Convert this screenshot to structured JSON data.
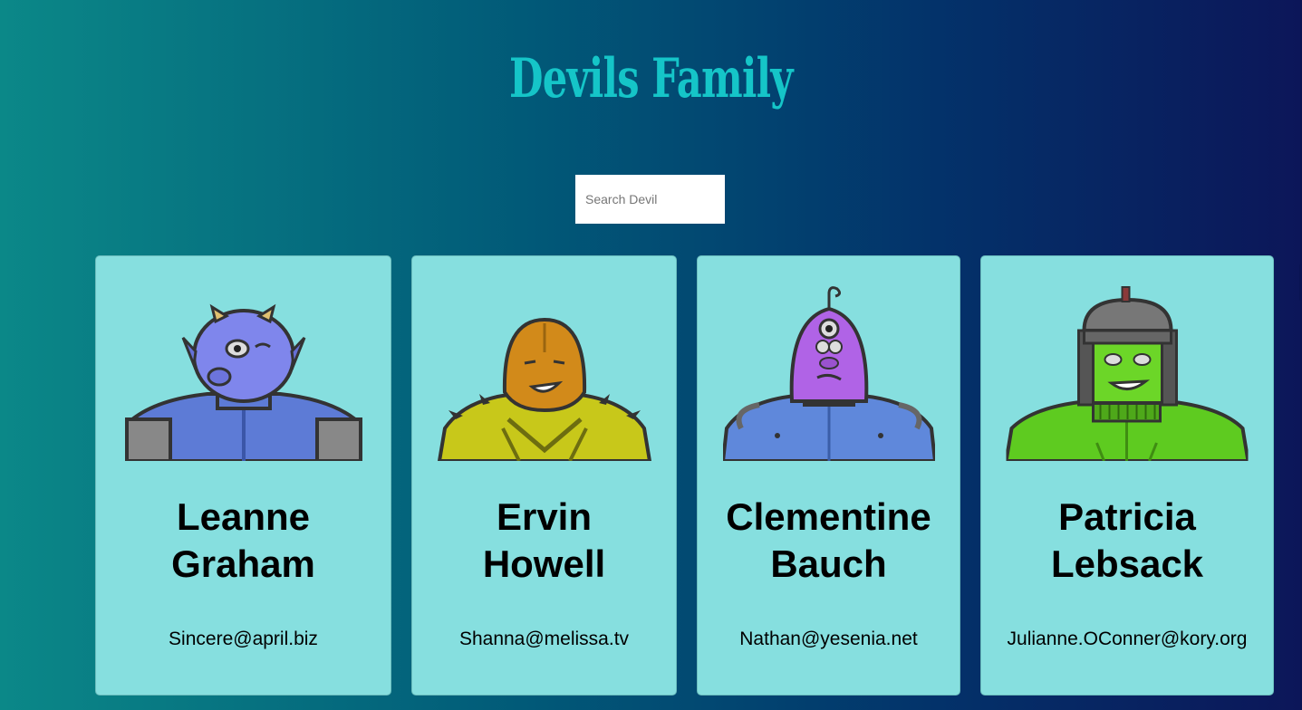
{
  "app": {
    "title": "Devils Family"
  },
  "search": {
    "placeholder": "Search Devil",
    "value": ""
  },
  "devils": [
    {
      "first": "Leanne",
      "last": "Graham",
      "email": "Sincere@april.biz",
      "avatar_icon": "blue-horned-monster-icon"
    },
    {
      "first": "Ervin",
      "last": "Howell",
      "email": "Shanna@melissa.tv",
      "avatar_icon": "orange-spiky-monster-icon"
    },
    {
      "first": "Clementine",
      "last": "Bauch",
      "email": "Nathan@yesenia.net",
      "avatar_icon": "purple-cyclops-robot-icon"
    },
    {
      "first": "Patricia",
      "last": "Lebsack",
      "email": "Julianne.OConner@kory.org",
      "avatar_icon": "green-helmet-monster-icon"
    }
  ],
  "colors": {
    "title": "#15c5c8",
    "card_background": "#86dfdf",
    "background_start": "#0b8888",
    "background_end": "#0c1659"
  }
}
